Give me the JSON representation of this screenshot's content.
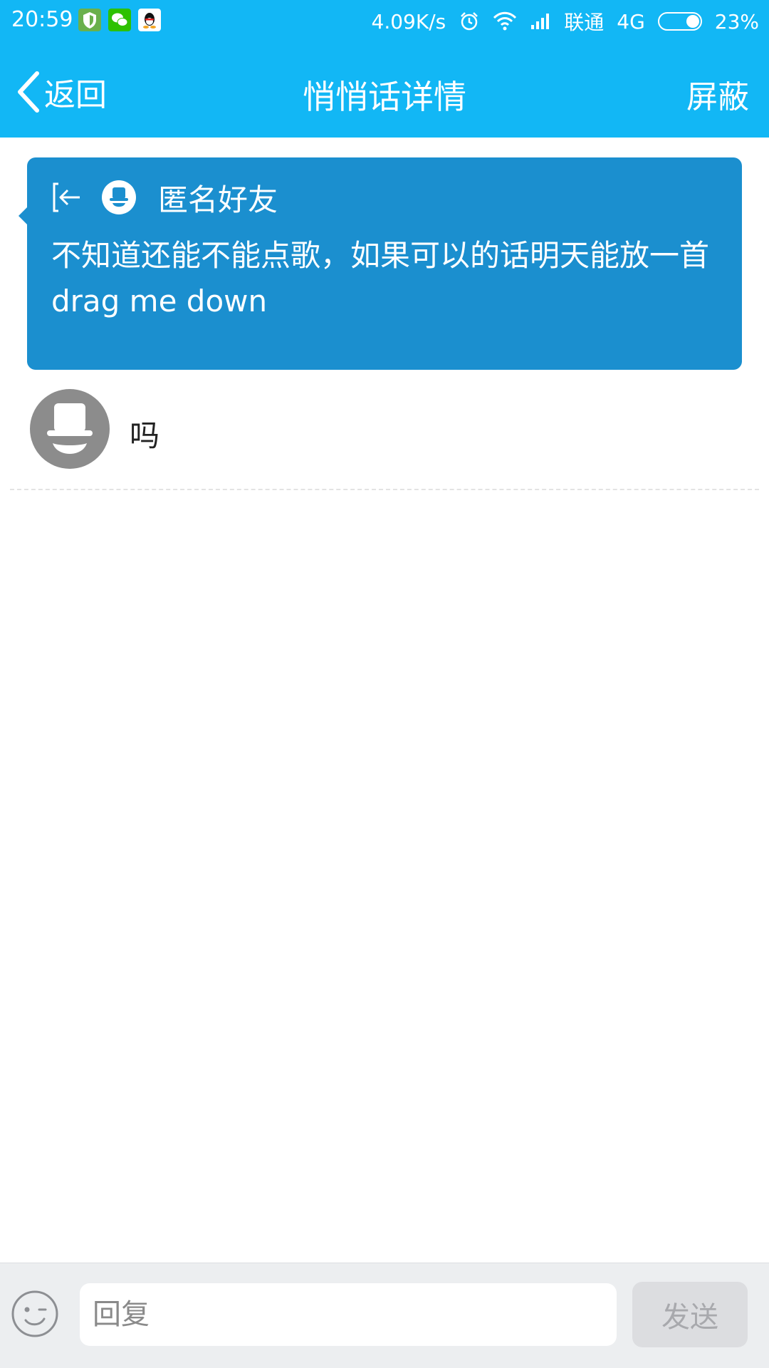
{
  "status_bar": {
    "time": "20:59",
    "network_speed": "4.09K/s",
    "carrier": "联通",
    "network_type": "4G",
    "battery": "23%",
    "icons": [
      "security-app-icon",
      "wechat-app-icon",
      "qq-app-icon",
      "alarm-icon",
      "wifi-icon",
      "signal-icon",
      "battery-icon"
    ]
  },
  "header": {
    "back_label": "返回",
    "title": "悄悄话详情",
    "block_label": "屏蔽"
  },
  "message": {
    "sender": "匿名好友",
    "text": "不知道还能不能点歌，如果可以的话明天能放一首drag me down"
  },
  "reply": {
    "text": "吗"
  },
  "input_bar": {
    "placeholder": "回复",
    "value": "",
    "send_label": "发送"
  },
  "colors": {
    "header_bg": "#12b7f5",
    "card_bg": "#1b8fcf",
    "avatar_gray": "#8c8c8c",
    "input_bar_bg": "#eceef0",
    "send_disabled_bg": "#dcdde0"
  }
}
